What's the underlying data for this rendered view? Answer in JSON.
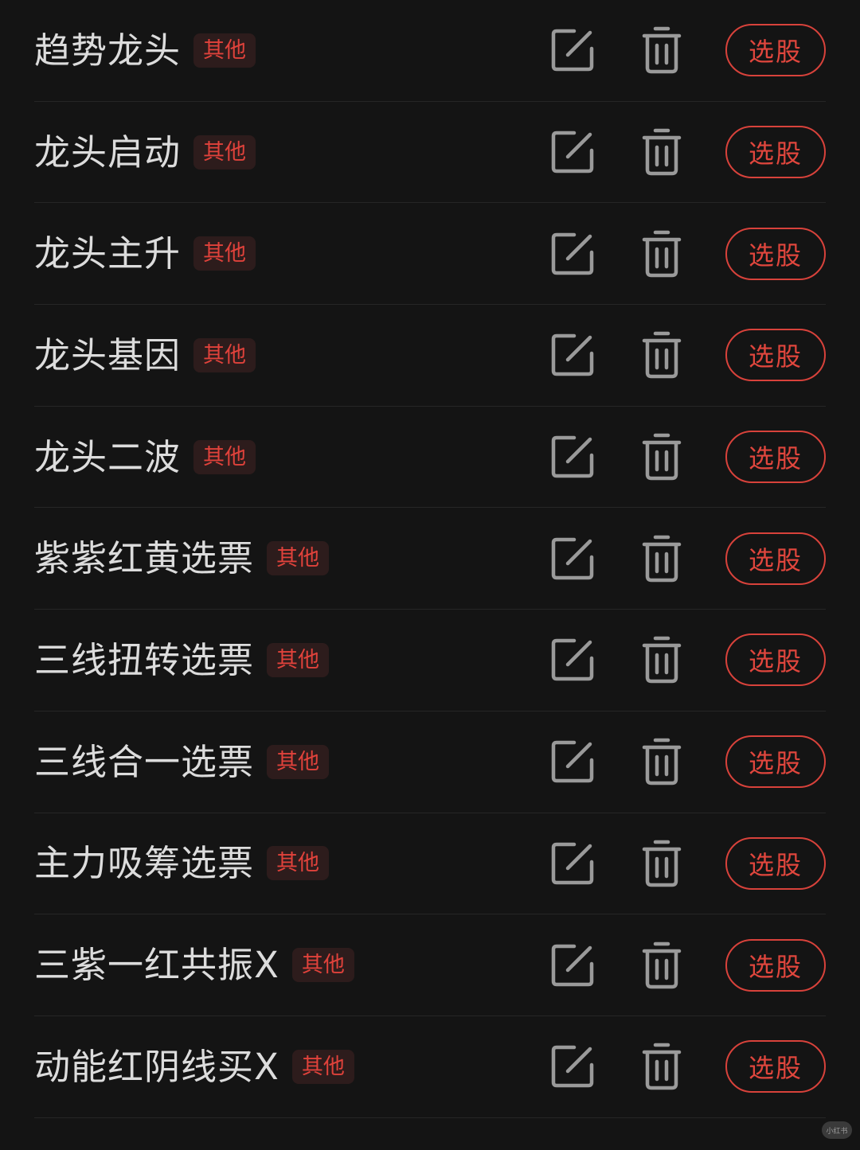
{
  "strategies": [
    {
      "name": "趋势龙头",
      "tag": "其他",
      "button": "选股"
    },
    {
      "name": "龙头启动",
      "tag": "其他",
      "button": "选股"
    },
    {
      "name": "龙头主升",
      "tag": "其他",
      "button": "选股"
    },
    {
      "name": "龙头基因",
      "tag": "其他",
      "button": "选股"
    },
    {
      "name": "龙头二波",
      "tag": "其他",
      "button": "选股"
    },
    {
      "name": "紫紫红黄选票",
      "tag": "其他",
      "button": "选股"
    },
    {
      "name": "三线扭转选票",
      "tag": "其他",
      "button": "选股"
    },
    {
      "name": "三线合一选票",
      "tag": "其他",
      "button": "选股"
    },
    {
      "name": "主力吸筹选票",
      "tag": "其他",
      "button": "选股"
    },
    {
      "name": "三紫一红共振X",
      "tag": "其他",
      "button": "选股"
    },
    {
      "name": "动能红阴线买X",
      "tag": "其他",
      "button": "选股"
    }
  ],
  "icons": {
    "edit": "edit-icon",
    "delete": "trash-icon"
  },
  "colors": {
    "background": "#141414",
    "accent": "#e0423b",
    "icon": "#9a9a9a"
  },
  "watermark": "小红书"
}
